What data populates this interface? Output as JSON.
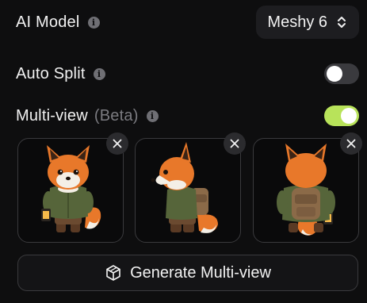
{
  "ai_model": {
    "label": "AI Model",
    "info_icon": "info-icon",
    "selected": "Meshy 6"
  },
  "auto_split": {
    "label": "Auto Split",
    "info_icon": "info-icon",
    "enabled": false
  },
  "multi_view": {
    "label": "Multi-view",
    "badge": "(Beta)",
    "info_icon": "info-icon",
    "enabled": true,
    "toggle_color": "#b8e35a",
    "views": [
      {
        "view": "front"
      },
      {
        "view": "side"
      },
      {
        "view": "back"
      }
    ]
  },
  "generate_button": {
    "label": "Generate Multi-view",
    "icon": "cube-icon"
  }
}
